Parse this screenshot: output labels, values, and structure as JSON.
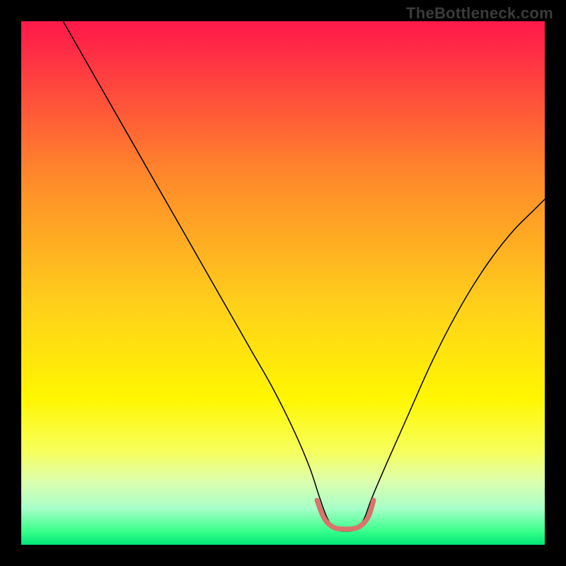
{
  "watermark": "TheBottleneck.com",
  "chart_data": {
    "type": "line",
    "title": "",
    "xlabel": "",
    "ylabel": "",
    "xlim": [
      0,
      100
    ],
    "ylim": [
      0,
      100
    ],
    "grid": false,
    "legend": false,
    "background": {
      "type": "vertical-gradient",
      "stops": [
        {
          "offset": 0.0,
          "color": "#ff1a4b"
        },
        {
          "offset": 0.03,
          "color": "#ff2248"
        },
        {
          "offset": 0.3,
          "color": "#ff8a2a"
        },
        {
          "offset": 0.55,
          "color": "#ffd21a"
        },
        {
          "offset": 0.72,
          "color": "#fff600"
        },
        {
          "offset": 0.82,
          "color": "#f7ff5a"
        },
        {
          "offset": 0.88,
          "color": "#dcffb0"
        },
        {
          "offset": 0.93,
          "color": "#a8ffc8"
        },
        {
          "offset": 0.975,
          "color": "#36ff8a"
        },
        {
          "offset": 1.0,
          "color": "#00e676"
        }
      ]
    },
    "series": [
      {
        "name": "curve",
        "stroke": "#000000",
        "stroke_width": 1.5,
        "x": [
          8,
          12,
          16,
          20,
          24,
          28,
          32,
          36,
          40,
          44,
          48,
          52,
          55,
          57,
          58.5,
          60,
          62,
          64,
          65.5,
          67,
          70,
          74,
          78,
          82,
          86,
          90,
          94,
          98,
          100
        ],
        "y": [
          100,
          93,
          86,
          79,
          72,
          65,
          58,
          51,
          44,
          37,
          30,
          22,
          15,
          9,
          5,
          3,
          2.6,
          3,
          5,
          9,
          16,
          25,
          34,
          42,
          49,
          55,
          60,
          64,
          66
        ]
      },
      {
        "name": "bottom-marker",
        "stroke": "#d9736b",
        "stroke_width": 7,
        "linecap": "round",
        "x": [
          56.5,
          57.5,
          58.5,
          60,
          62,
          64,
          65.5,
          66.5,
          67.3
        ],
        "y": [
          8.5,
          5.8,
          4.2,
          3.2,
          3.0,
          3.2,
          4.2,
          5.8,
          8.5
        ]
      }
    ]
  }
}
